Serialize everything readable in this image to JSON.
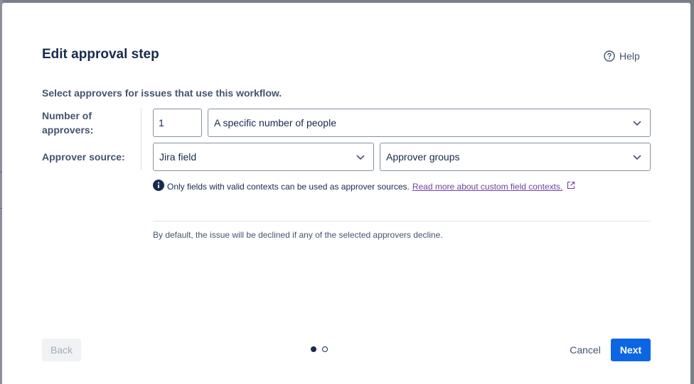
{
  "modal": {
    "title": "Edit approval step",
    "help_label": "Help",
    "intro": "Select approvers for issues that use this workflow.",
    "number_of_approvers": {
      "label": "Number of approvers:",
      "value": "1",
      "mode_selected": "A specific number of people"
    },
    "approver_source": {
      "label": "Approver source:",
      "source_selected": "Jira field",
      "field_selected": "Approver groups"
    },
    "info": {
      "text": "Only fields with valid contexts can be used as approver sources.",
      "link_text": "Read more about custom field contexts."
    },
    "default_note": "By default, the issue will be declined if any of the selected approvers decline.",
    "footer": {
      "back_label": "Back",
      "cancel_label": "Cancel",
      "next_label": "Next",
      "steps_total": 2,
      "step_current": 1
    }
  },
  "colors": {
    "primary": "#0c66e4",
    "text": "#172b4d",
    "subtle_text": "#44546f",
    "link_visited": "#6e3fa3",
    "backdrop": "#7a7f87"
  }
}
